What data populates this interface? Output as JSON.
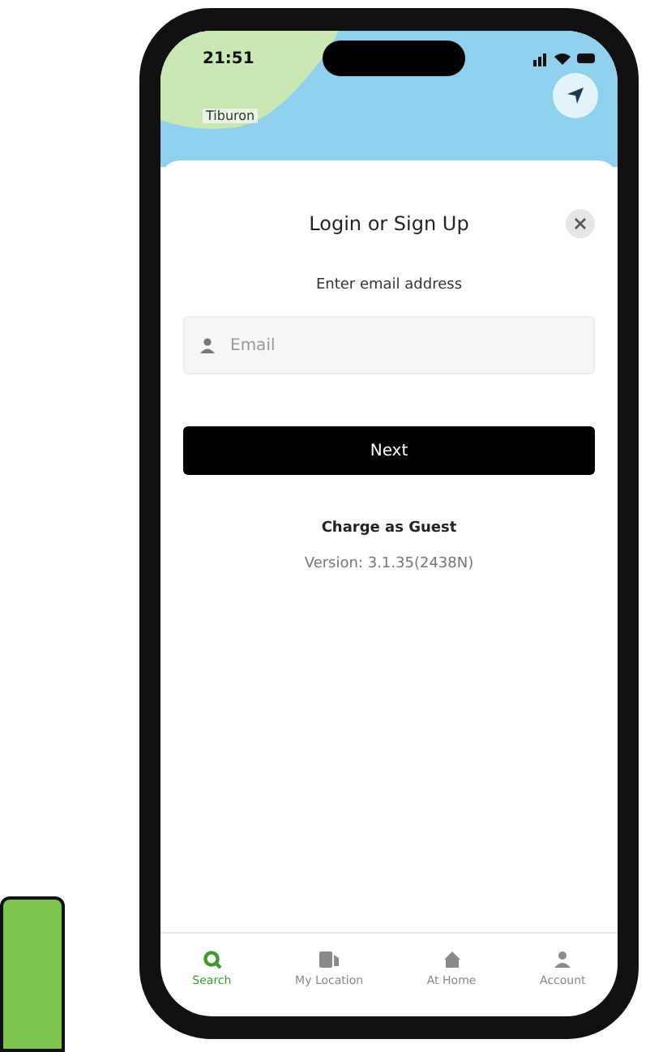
{
  "status_bar": {
    "time": "21:51"
  },
  "map": {
    "place_label": "Tiburon"
  },
  "sheet": {
    "title": "Login or Sign Up",
    "prompt": "Enter email address",
    "email_field": {
      "placeholder": "Email"
    },
    "next_button": "Next",
    "guest_link": "Charge as Guest",
    "version": "Version: 3.1.35(2438N)"
  },
  "tabs": [
    {
      "label": "Search",
      "kind": "search",
      "selected": true
    },
    {
      "label": "My Location",
      "kind": "location",
      "selected": false
    },
    {
      "label": "At Home",
      "kind": "home",
      "selected": false
    },
    {
      "label": "Account",
      "kind": "account",
      "selected": false
    }
  ]
}
